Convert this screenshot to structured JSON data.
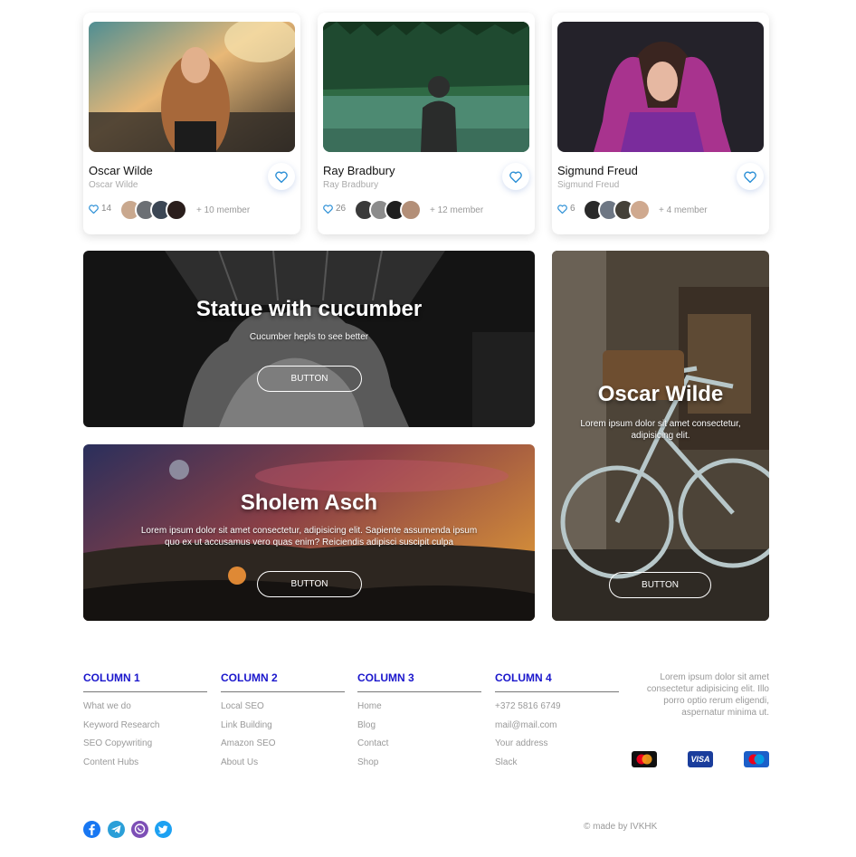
{
  "cards": [
    {
      "name": "Oscar Wilde",
      "subtitle": "Oscar Wilde",
      "likes": "14",
      "members": "+ 10 member"
    },
    {
      "name": "Ray Bradbury",
      "subtitle": "Ray Bradbury",
      "likes": "26",
      "members": "+ 12 member"
    },
    {
      "name": "Sigmund Freud",
      "subtitle": "Sigmund Freud",
      "likes": "6",
      "members": "+ 4 member"
    }
  ],
  "heroes": {
    "statue": {
      "title": "Statue with cucumber",
      "text": "Cucumber hepls to see better",
      "button": "BUTTON"
    },
    "sholem": {
      "title": "Sholem Asch",
      "text_line1": "Lorem ipsum dolor sit amet consectetur, adipisicing elit. Sapiente assumenda ipsum",
      "text_line2": "quo ex ut accusamus vero quas enim? Reiciendis adipisci suscipit culpa",
      "button": "BUTTON"
    },
    "oscar": {
      "title": "Oscar Wilde",
      "text_line1": "Lorem ipsum dolor sit amet consectetur,",
      "text_line2": "adipisicing elit.",
      "button": "BUTTON"
    }
  },
  "footer": {
    "columns": [
      {
        "title": "COLUMN 1",
        "items": [
          "What we do",
          "Keyword Research",
          "SEO Copywriting",
          "Content Hubs"
        ]
      },
      {
        "title": "COLUMN 2",
        "items": [
          "Local SEO",
          "Link Building",
          "Amazon SEO",
          "About Us"
        ]
      },
      {
        "title": "COLUMN 3",
        "items": [
          "Home",
          "Blog",
          "Contact",
          "Shop"
        ]
      },
      {
        "title": "COLUMN 4",
        "items": [
          "+372 5816 6749",
          "mail@mail.com",
          "Your address",
          "Slack"
        ]
      }
    ],
    "about_lines": [
      "Lorem ipsum dolor sit amet",
      "consectetur adipisicing elit. Illo",
      "porro optio rerum eligendi,",
      "aspernatur minima ut."
    ],
    "payments": {
      "visa": "VISA",
      "maestro": "Maestro"
    },
    "social_icons": [
      "facebook-icon",
      "telegram-icon",
      "viber-icon",
      "twitter-icon"
    ],
    "copyright": "© made by IVKHK"
  },
  "colors": {
    "accent": "#1a16cc",
    "heart": "#2b8fd6"
  }
}
